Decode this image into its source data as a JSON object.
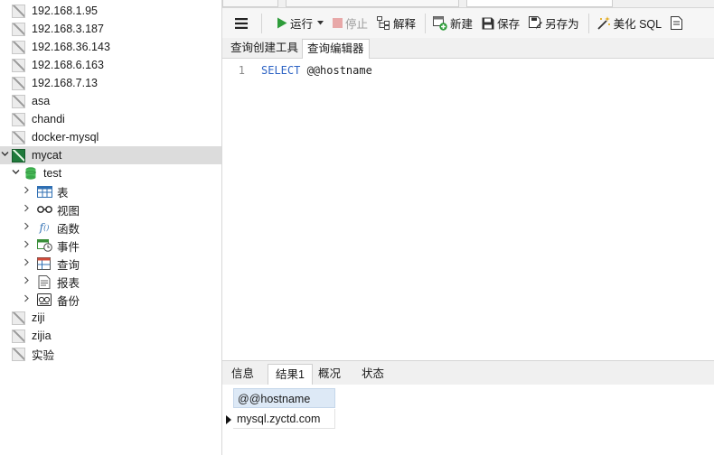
{
  "sidebar": {
    "connections_top": [
      {
        "label": "192.168.1.95"
      },
      {
        "label": "192.168.3.187"
      },
      {
        "label": "192.168.36.143"
      },
      {
        "label": "192.168.6.163"
      },
      {
        "label": "192.168.7.13"
      },
      {
        "label": "asa"
      },
      {
        "label": "chandi"
      },
      {
        "label": "docker-mysql"
      }
    ],
    "active_connection": {
      "label": "mycat",
      "expanded": true
    },
    "database": {
      "label": "test",
      "expanded": true
    },
    "objects": [
      {
        "label": "表",
        "icon": "table-icon"
      },
      {
        "label": "视图",
        "icon": "view-icon"
      },
      {
        "label": "函数",
        "icon": "function-icon"
      },
      {
        "label": "事件",
        "icon": "event-icon"
      },
      {
        "label": "查询",
        "icon": "query-icon"
      },
      {
        "label": "报表",
        "icon": "report-icon"
      },
      {
        "label": "备份",
        "icon": "backup-icon"
      }
    ],
    "connections_bottom": [
      {
        "label": "ziji"
      },
      {
        "label": "zijia"
      },
      {
        "label": "实验"
      }
    ]
  },
  "toolbar": {
    "menu_icon": "hamburger-icon",
    "run_label": "运行",
    "stop_label": "停止",
    "explain_label": "解释",
    "new_label": "新建",
    "save_label": "保存",
    "save_as_label": "另存为",
    "beautify_label": "美化 SQL"
  },
  "editor_tabs": [
    {
      "label": "查询创建工具",
      "active": false
    },
    {
      "label": "查询编辑器",
      "active": true
    }
  ],
  "editor": {
    "line_number": "1",
    "keyword": "SELECT",
    "rest": " @@hostname"
  },
  "result_tabs": [
    {
      "label": "信息",
      "active": false
    },
    {
      "label": "结果1",
      "active": true
    },
    {
      "label": "概况",
      "active": false
    },
    {
      "label": "状态",
      "active": false
    }
  ],
  "result_grid": {
    "columns": [
      "@@hostname"
    ],
    "rows": [
      [
        "mysql.zyctd.com"
      ]
    ]
  },
  "colors": {
    "accent_green": "#1f7a3b",
    "keyword_blue": "#2d63c4",
    "grid_header": "#dde9f6",
    "selection": "#dcdcdc"
  }
}
